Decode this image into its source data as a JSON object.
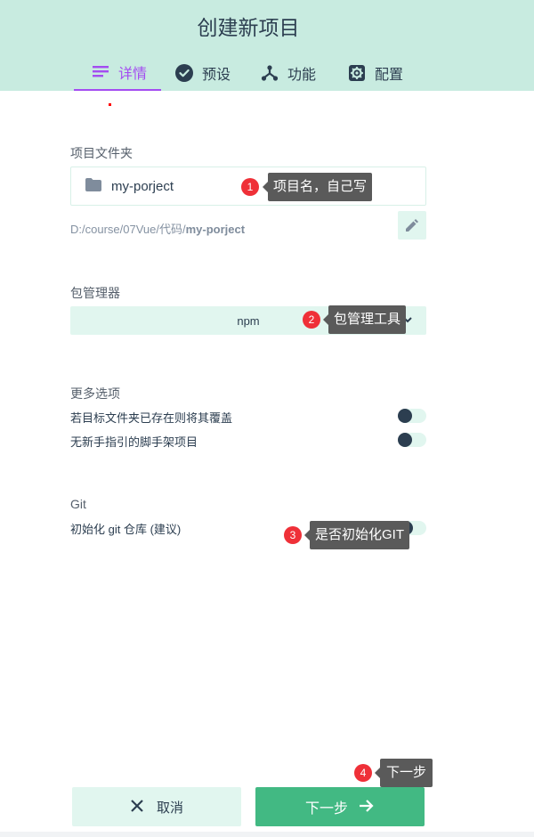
{
  "header": {
    "title": "创建新项目"
  },
  "tabs": [
    {
      "label": "详情",
      "icon": "list-icon",
      "active": true
    },
    {
      "label": "预设",
      "icon": "check-circle-icon"
    },
    {
      "label": "功能",
      "icon": "fork-icon"
    },
    {
      "label": "配置",
      "icon": "gear-icon"
    }
  ],
  "folder": {
    "label": "项目文件夹",
    "value": "my-porject",
    "path_prefix": "D:/course/07Vue/代码/",
    "path_name": "my-porject"
  },
  "package_manager": {
    "label": "包管理器",
    "value": "npm"
  },
  "more_options": {
    "label": "更多选项",
    "items": [
      {
        "label": "若目标文件夹已存在则将其覆盖"
      },
      {
        "label": "无新手指引的脚手架项目"
      }
    ]
  },
  "git": {
    "label": "Git",
    "init_label": "初始化 git 仓库 (建议)"
  },
  "annotations": [
    {
      "num": "1",
      "text": "项目名，自己写"
    },
    {
      "num": "2",
      "text": "包管理工具"
    },
    {
      "num": "3",
      "text": "是否初始化GIT"
    },
    {
      "num": "4",
      "text": "下一步"
    }
  ],
  "buttons": {
    "cancel": "取消",
    "next": "下一步"
  },
  "colors": {
    "header_bg": "#c8ebe0",
    "accent": "#42b983",
    "tab_active": "#a44cf1",
    "light_green": "#e1f6ef",
    "callout_bg": "#5a5a5a",
    "badge_red": "#ef3038"
  }
}
